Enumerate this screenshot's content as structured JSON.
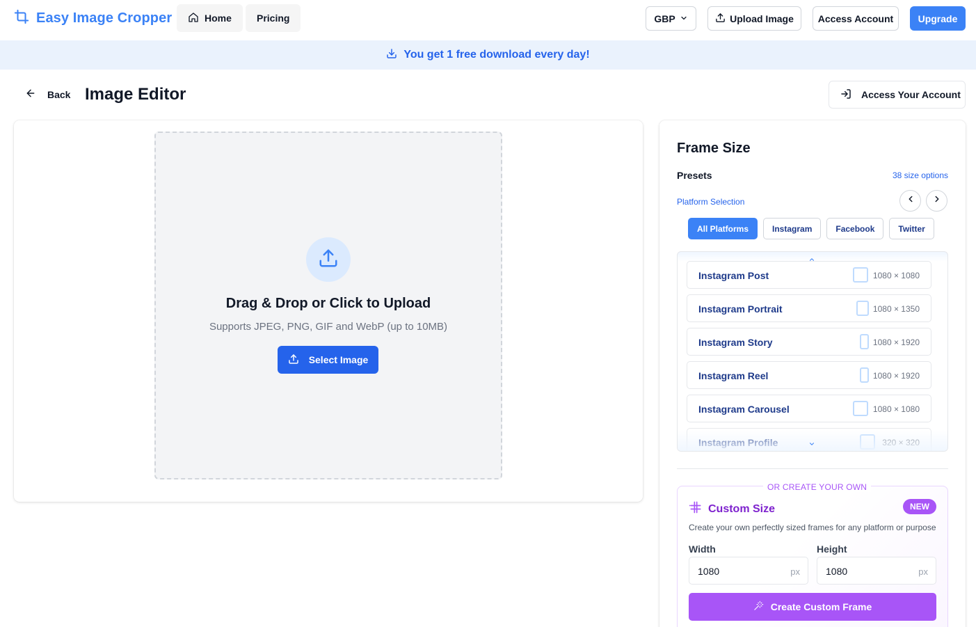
{
  "header": {
    "logo_text": "Easy Image Cropper",
    "nav": [
      {
        "label": "Home",
        "icon": "home-icon"
      },
      {
        "label": "Pricing"
      }
    ],
    "currency": "GBP",
    "upload_label": "Upload Image",
    "account_label": "Access Account",
    "upgrade_label": "Upgrade"
  },
  "banner": {
    "text": "You get 1 free download every day!",
    "icon": "download-icon"
  },
  "page": {
    "back_label": "Back",
    "title": "Image Editor",
    "account_button": "Access Your Account"
  },
  "upload": {
    "title": "Drag & Drop or Click to Upload",
    "subtitle": "Supports JPEG, PNG, GIF and WebP (up to 10MB)",
    "button": "Select Image"
  },
  "frame_size": {
    "title": "Frame Size",
    "presets_label": "Presets",
    "options_count": "38 size options",
    "platform_label": "Platform Selection",
    "tabs": [
      {
        "label": "All Platforms",
        "active": true
      },
      {
        "label": "Instagram",
        "active": false
      },
      {
        "label": "Facebook",
        "active": false
      },
      {
        "label": "Twitter",
        "active": false
      }
    ],
    "presets": [
      {
        "name": "Instagram Post",
        "dims": "1080 × 1080"
      },
      {
        "name": "Instagram Portrait",
        "dims": "1080 × 1350"
      },
      {
        "name": "Instagram Story",
        "dims": "1080 × 1920"
      },
      {
        "name": "Instagram Reel",
        "dims": "1080 × 1920"
      },
      {
        "name": "Instagram Carousel",
        "dims": "1080 × 1080"
      },
      {
        "name": "Instagram Profile",
        "dims": "320 × 320"
      }
    ]
  },
  "custom": {
    "or_label": "OR CREATE YOUR OWN",
    "title": "Custom Size",
    "badge": "NEW",
    "description": "Create your own perfectly sized frames for any platform or purpose",
    "width_label": "Width",
    "height_label": "Height",
    "width_value": "1080",
    "height_value": "1080",
    "unit": "px",
    "button": "Create Custom Frame"
  },
  "colors": {
    "primary": "#3b82f6",
    "accent": "#a855f7",
    "banner_bg": "#eaf2fd"
  }
}
